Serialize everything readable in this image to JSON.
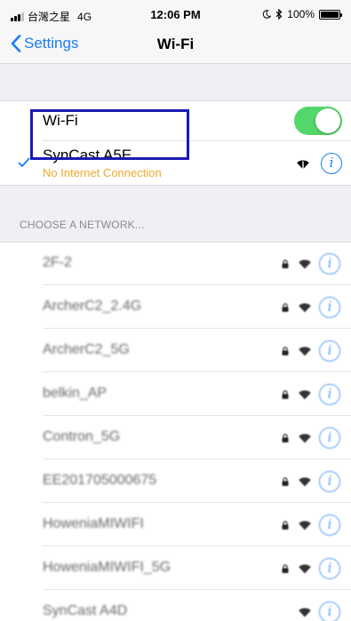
{
  "status_bar": {
    "carrier": "台灣之星",
    "network_type": "4G",
    "time": "12:06 PM",
    "battery_percent": "100%",
    "battery_level": 1.0,
    "signal_bars_filled": 3,
    "signal_bars_total": 4
  },
  "nav": {
    "back_label": "Settings",
    "title": "Wi-Fi"
  },
  "wifi_toggle": {
    "label": "Wi-Fi",
    "on": true
  },
  "connected_network": {
    "name": "SynCast A5E",
    "status": "No Internet Connection",
    "status_color": "#f0a830"
  },
  "section_header": "CHOOSE A NETWORK...",
  "networks": [
    {
      "name": "2F-2",
      "secured": true
    },
    {
      "name": "ArcherC2_2.4G",
      "secured": true
    },
    {
      "name": "ArcherC2_5G",
      "secured": true
    },
    {
      "name": "belkin_AP",
      "secured": true
    },
    {
      "name": "Contron_5G",
      "secured": true
    },
    {
      "name": "EE201705000675",
      "secured": true
    },
    {
      "name": "HoweniaMIWIFI",
      "secured": true
    },
    {
      "name": "HoweniaMIWIFI_5G",
      "secured": true
    },
    {
      "name": "SynCast A4D",
      "secured": false
    }
  ],
  "info_glyph": "i",
  "colors": {
    "accent": "#1a7cf5",
    "switch_on": "#53d76a",
    "highlight_box": "#1a1ab4"
  }
}
